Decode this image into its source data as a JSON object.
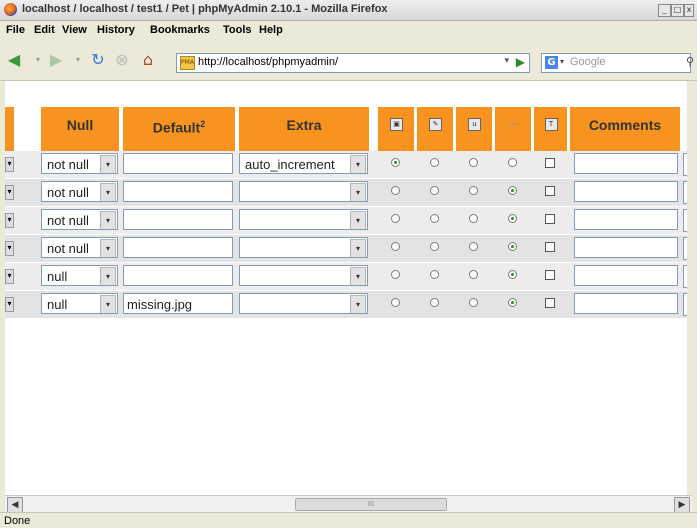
{
  "window": {
    "title": "localhost / localhost / test1 / Pet | phpMyAdmin 2.10.1 - Mozilla Firefox",
    "controls": [
      "_",
      "□",
      "x"
    ]
  },
  "menu": [
    "File",
    "Edit",
    "View",
    "History",
    "Bookmarks",
    "Tools",
    "Help"
  ],
  "addressbar": {
    "url": "http://localhost/phpmyadmin/"
  },
  "search": {
    "engine": "G",
    "placeholder": "Google"
  },
  "table": {
    "headers": {
      "null": "Null",
      "default": "Default",
      "default_sup": "2",
      "extra": "Extra",
      "comments": "Comments",
      "icons": [
        "primary-key-icon",
        "index-icon",
        "unique-icon",
        "---",
        "fulltext-icon"
      ],
      "dash": "---"
    },
    "rows": [
      {
        "null": "not null",
        "default": "",
        "extra": "auto_increment",
        "radio": 0
      },
      {
        "null": "not null",
        "default": "",
        "extra": "",
        "radio": 3
      },
      {
        "null": "not null",
        "default": "",
        "extra": "",
        "radio": 3
      },
      {
        "null": "not null",
        "default": "",
        "extra": "",
        "radio": 3
      },
      {
        "null": "null",
        "default": "",
        "extra": "",
        "radio": 3
      },
      {
        "null": "null",
        "default": "missing.jpg",
        "extra": "",
        "radio": 3
      }
    ]
  },
  "scrollbar": {
    "thumb_grip": "III"
  },
  "status": "Done"
}
